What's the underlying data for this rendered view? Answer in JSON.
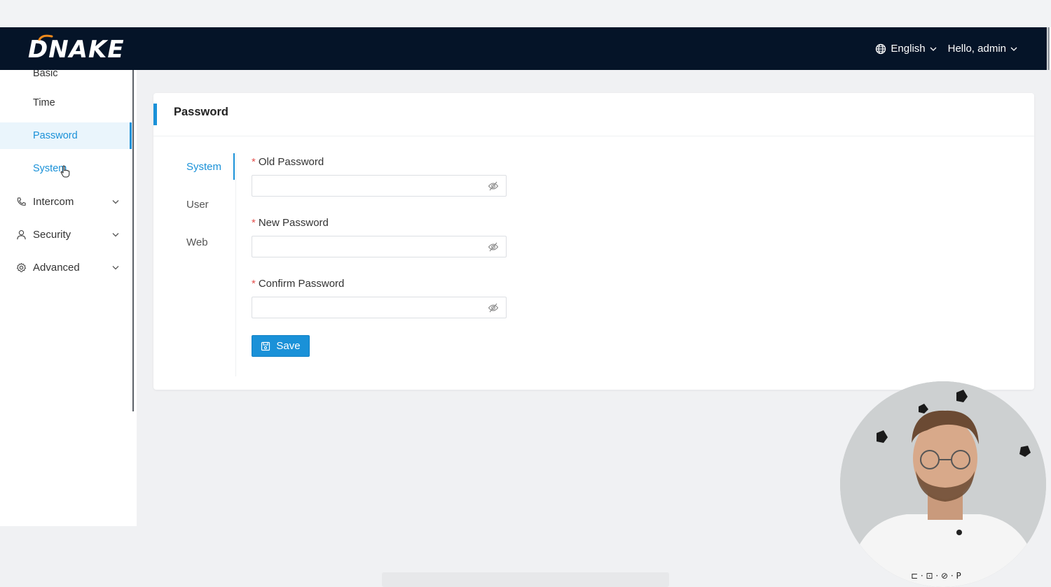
{
  "header": {
    "logo_text": "DNAKE",
    "language": "English",
    "greeting": "Hello, admin"
  },
  "sidebar": {
    "sub_items": [
      {
        "label": "Basic"
      },
      {
        "label": "Time"
      },
      {
        "label": "Password",
        "active": true
      },
      {
        "label": "System"
      }
    ],
    "groups": [
      {
        "label": "Intercom",
        "icon": "phone-icon"
      },
      {
        "label": "Security",
        "icon": "user-icon"
      },
      {
        "label": "Advanced",
        "icon": "gear-icon"
      }
    ]
  },
  "card": {
    "title": "Password",
    "tabs": [
      {
        "label": "System",
        "active": true
      },
      {
        "label": "User"
      },
      {
        "label": "Web"
      }
    ],
    "fields": [
      {
        "label": "Old Password",
        "required_mark": "*",
        "value": ""
      },
      {
        "label": "New Password",
        "required_mark": "*",
        "value": ""
      },
      {
        "label": "Confirm Password",
        "required_mark": "*",
        "value": ""
      }
    ],
    "save_label": "Save"
  },
  "colors": {
    "accent": "#1a91d8",
    "header_bg": "#051428",
    "required": "#e4524f"
  },
  "overlay": {
    "webcam_watermark": "P"
  }
}
